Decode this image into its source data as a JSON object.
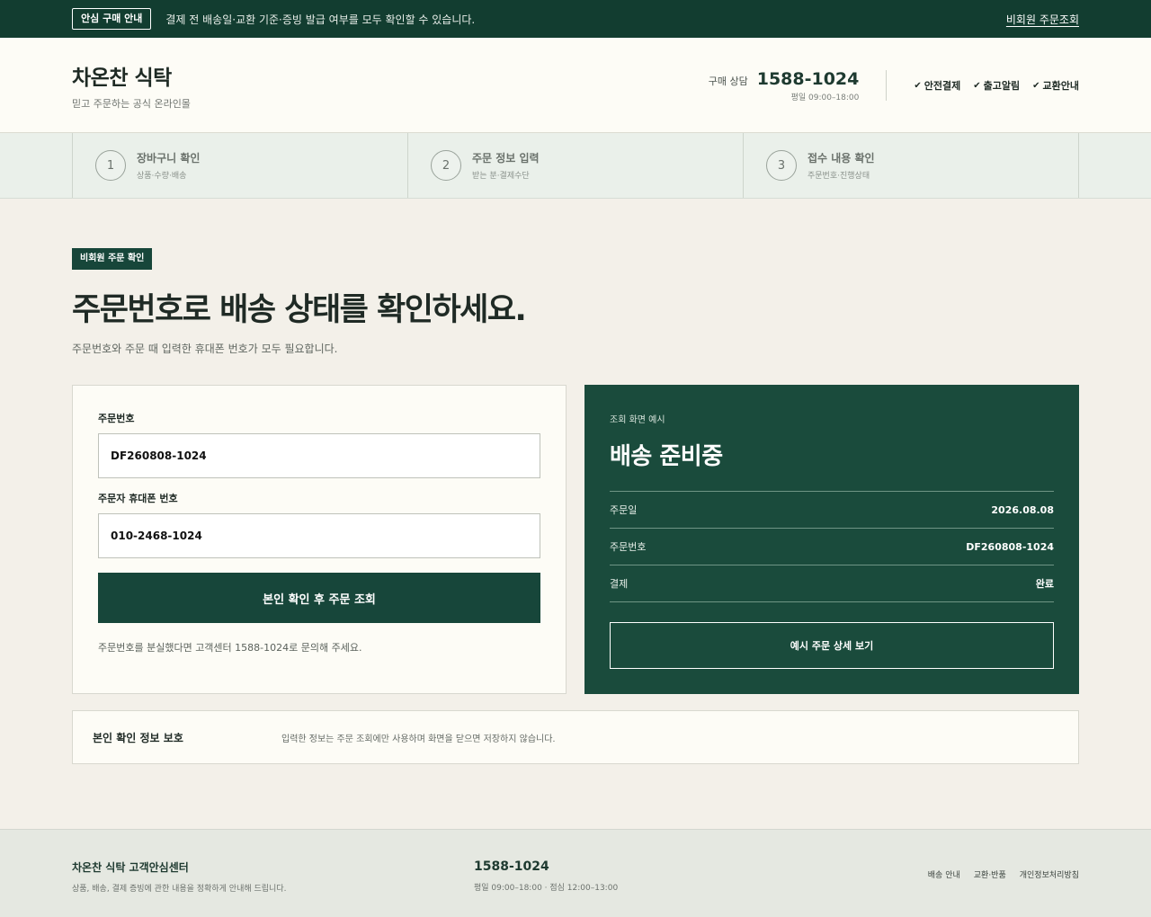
{
  "topbar": {
    "badge": "안심 구매 안내",
    "notice": "결제 전 배송일·교환 기준·증빙 발급 여부를 모두 확인할 수 있습니다.",
    "guest_order_link": "비회원 주문조회"
  },
  "header": {
    "brand_title": "차온찬 식탁",
    "brand_sub": "믿고 주문하는 공식 온라인몰",
    "phone_label": "구매 상담",
    "phone_number": "1588-1024",
    "phone_hours": "평일 09:00–18:00",
    "trust_items": [
      "안전결제",
      "출고알림",
      "교환안내"
    ]
  },
  "steps": [
    {
      "num": "1",
      "title": "장바구니 확인",
      "sub": "상품·수량·배송"
    },
    {
      "num": "2",
      "title": "주문 정보 입력",
      "sub": "받는 분·결제수단"
    },
    {
      "num": "3",
      "title": "접수 내용 확인",
      "sub": "주문번호·진행상태"
    }
  ],
  "main": {
    "tag": "비회원 주문 확인",
    "title": "주문번호로 배송 상태를 확인하세요.",
    "desc": "주문번호와 주문 때 입력한 휴대폰 번호가 모두 필요합니다."
  },
  "form": {
    "order_label": "주문번호",
    "order_value": "DF260808-1024",
    "phone_label": "주문자 휴대폰 번호",
    "phone_value": "010-2468-1024",
    "submit_label": "본인 확인 후 주문 조회",
    "help": "주문번호를 분실했다면 고객센터 1588-1024로 문의해 주세요."
  },
  "example": {
    "label": "조회 화면 예시",
    "status": "배송 준비중",
    "rows": [
      {
        "key": "주문일",
        "value": "2026.08.08"
      },
      {
        "key": "주문번호",
        "value": "DF260808-1024"
      },
      {
        "key": "결제",
        "value": "완료"
      }
    ],
    "button_label": "예시 주문 상세 보기"
  },
  "privacy": {
    "title": "본인 확인 정보 보호",
    "text": "입력한 정보는 주문 조회에만 사용하며 화면을 닫으면 저장하지 않습니다."
  },
  "footer": {
    "title": "차온찬 식탁 고객안심센터",
    "sub": "상품, 배송, 결제 증빙에 관한 내용을 정확하게 안내해 드립니다.",
    "phone": "1588-1024",
    "hours": "평일 09:00–18:00 · 점심 12:00–13:00",
    "links": [
      "배송 안내",
      "교환·반품",
      "개인정보처리방침"
    ]
  },
  "colors": {
    "primary": "#17463a",
    "topbar": "#123d30",
    "panel": "#1a4b3c",
    "background": "#f3f0e9"
  },
  "icons": {
    "trust": "check-icon"
  }
}
